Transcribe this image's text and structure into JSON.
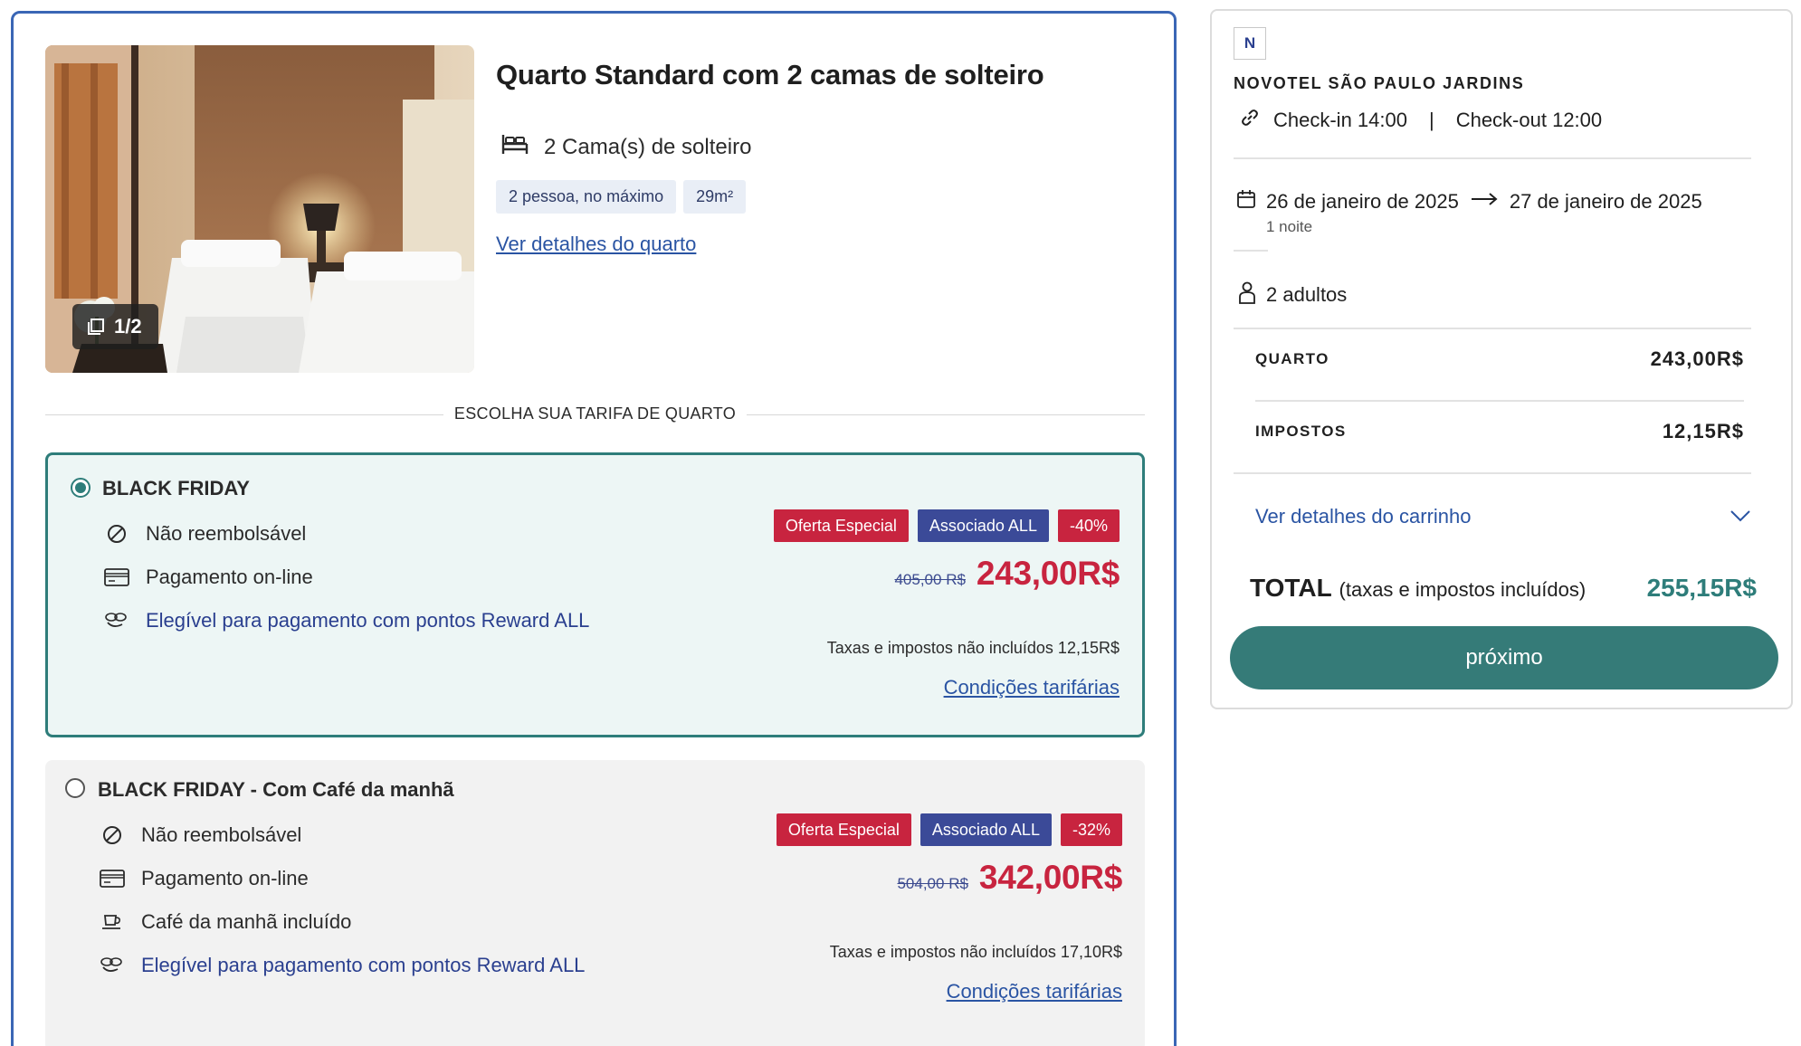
{
  "room": {
    "title": "Quarto Standard com 2 camas de solteiro",
    "beds": "2 Cama(s) de solteiro",
    "tags": [
      "2 pessoa, no máximo",
      "29m²"
    ],
    "details_link": "Ver detalhes do quarto",
    "photo_counter": "1/2"
  },
  "section_label": "ESCOLHA SUA TARIFA DE QUARTO",
  "rates": [
    {
      "name": "BLACK FRIDAY",
      "selected": true,
      "features": [
        {
          "icon": "no-refund-icon",
          "text": "Não reembolsável"
        },
        {
          "icon": "credit-card-icon",
          "text": "Pagamento on-line"
        },
        {
          "icon": "reward-points-icon",
          "text": "Elegível para pagamento com pontos Reward ALL"
        }
      ],
      "badges": [
        "Oferta Especial",
        "Associado ALL",
        "-40%"
      ],
      "old_price": "405,00 R$",
      "price": "243,00R$",
      "taxes_note": "Taxas e impostos não incluídos 12,15R$",
      "conditions_link": "Condições tarifárias"
    },
    {
      "name": "BLACK FRIDAY - Com Café da manhã",
      "selected": false,
      "features": [
        {
          "icon": "no-refund-icon",
          "text": "Não reembolsável"
        },
        {
          "icon": "credit-card-icon",
          "text": "Pagamento on-line"
        },
        {
          "icon": "coffee-cup-icon",
          "text": "Café da manhã incluído"
        },
        {
          "icon": "reward-points-icon",
          "text": "Elegível para pagamento com pontos Reward ALL"
        }
      ],
      "badges": [
        "Oferta Especial",
        "Associado ALL",
        "-32%"
      ],
      "old_price": "504,00 R$",
      "price": "342,00R$",
      "taxes_note": "Taxas e impostos não incluídos 17,10R$",
      "conditions_link": "Condições tarifárias"
    }
  ],
  "summary": {
    "hotel_name": "NOVOTEL SÃO PAULO JARDINS",
    "logo_letter": "N",
    "checkin": "Check-in 14:00",
    "separator": "|",
    "checkout": "Check-out 12:00",
    "date_from": "26 de janeiro de 2025",
    "date_to": "27 de janeiro de 2025",
    "nights": "1 noite",
    "guests": "2 adultos",
    "room_label": "QUARTO",
    "room_value": "243,00R$",
    "taxes_label": "IMPOSTOS",
    "taxes_value": "12,15R$",
    "cart_link": "Ver detalhes do carrinho",
    "total_label": "TOTAL",
    "total_sub": "(taxas e impostos incluídos)",
    "total_value": "255,15R$",
    "next_button": "próximo"
  },
  "colors": {
    "accent_teal": "#2e7d7a",
    "promo_red": "#c8243f",
    "navy": "#3b4a98",
    "link_blue": "#2a54a3",
    "card_border": "#3a66b5"
  }
}
